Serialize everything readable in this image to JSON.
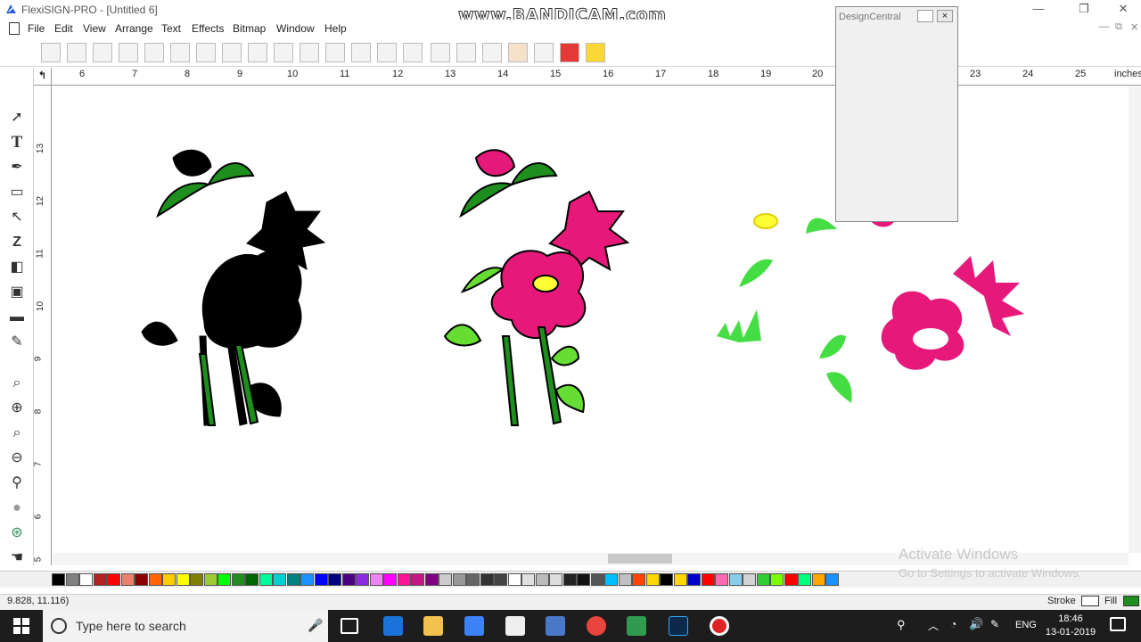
{
  "window": {
    "title": "FlexiSIGN-PRO - [Untitled 6]",
    "watermark": "www.BANDICAM.com",
    "minimize": "—",
    "maximize": "❐",
    "close": "✕"
  },
  "menu": [
    "File",
    "Edit",
    "View",
    "Arrange",
    "Text",
    "Effects",
    "Bitmap",
    "Window",
    "Help"
  ],
  "mdi_controls": [
    "—",
    "⧉",
    "✕"
  ],
  "ruler": {
    "units": "inches",
    "h_labels": [
      "6",
      "7",
      "8",
      "9",
      "10",
      "11",
      "12",
      "13",
      "14",
      "15",
      "16",
      "17",
      "18",
      "19",
      "20",
      "",
      "",
      "23",
      "24",
      "25"
    ],
    "v_labels": [
      "13",
      "12",
      "11",
      "10",
      "9",
      "8",
      "7",
      "6",
      "5"
    ],
    "corner": "↰"
  },
  "left_tools": [
    "select-arrow",
    "T",
    "shape-pen",
    "rect",
    "node-edit",
    "Z",
    "fill-gray",
    "square",
    "ruler",
    "eyedropper",
    "zoom-magnify",
    "zoom-in",
    "zoom-page",
    "zoom-out",
    "zoom-fit",
    "zoom-gray",
    "zoom-green",
    "pan"
  ],
  "design_central": {
    "title": "DesignCentral",
    "close": "×"
  },
  "status": {
    "coords": "9.828,     11.116)",
    "stroke_label": "Stroke",
    "fill_label": "Fill",
    "stroke_color": "#ffffff",
    "fill_color": "#1e8f1e"
  },
  "activate": {
    "line1": "Activate Windows",
    "line2": "Go to Settings to activate Windows."
  },
  "taskbar": {
    "search_placeholder": "Type here to search",
    "time": "18:46",
    "date": "13-01-2019",
    "lang": "ENG"
  },
  "palette": [
    "#000000",
    "#808080",
    "#ffffff",
    "#b22222",
    "#ff0000",
    "#e8826b",
    "#8b0000",
    "#ff6600",
    "#ffcc00",
    "#ffff00",
    "#808000",
    "#9acd32",
    "#00ff00",
    "#228b22",
    "#006400",
    "#00fa9a",
    "#00ced1",
    "#008080",
    "#1e90ff",
    "#0000ff",
    "#000080",
    "#4b0082",
    "#8a2be2",
    "#ee82ee",
    "#ff00ff",
    "#ff1493",
    "#c71585",
    "#800080",
    "#cccccc",
    "#999999",
    "#666666",
    "#333333",
    "#444444",
    "#ffffff",
    "#e0e0e0",
    "#bbbbbb",
    "#dddddd",
    "#222222",
    "#111111",
    "#555555",
    "#00bfff",
    "#c0c0c0",
    "#ff4500",
    "#ffd700",
    "#000000",
    "#ffd700",
    "#0000cd",
    "#ff0000",
    "#ff69b4",
    "#87ceeb",
    "#d3d3d3",
    "#32cd32",
    "#7cfc00",
    "#ff0000",
    "#00ff7f",
    "#ffa500",
    "#1e90ff"
  ]
}
